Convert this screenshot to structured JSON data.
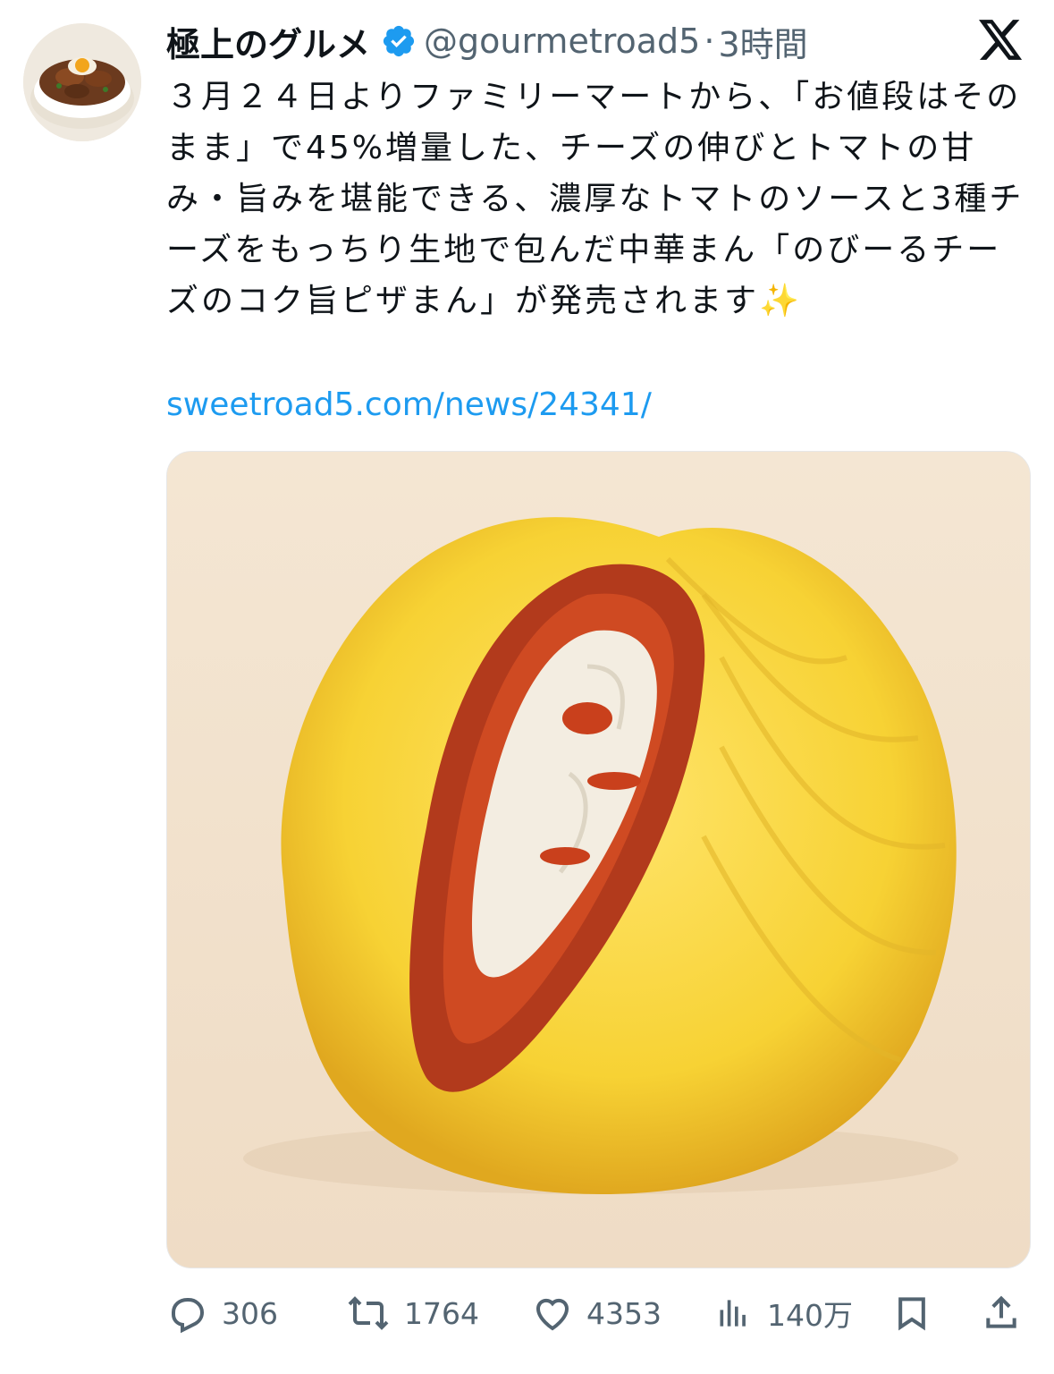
{
  "tweet": {
    "display_name": "極上のグルメ",
    "handle": "@gourmetroad5",
    "separator": "·",
    "time": "3時間",
    "text": "３月２４日よりファミリーマートから、「お値段はそのまま」で45%増量した、チーズの伸びとトマトの甘み・旨みを堪能できる、濃厚なトマトのソースと3種チーズをもっちり生地で包んだ中華まん「のびーるチーズのコク旨ピザまん」が発売されます",
    "sparkle": "✨",
    "link": "sweetroad5.com/news/24341/"
  },
  "icons": {
    "avatar": "avatar-food-bowl",
    "verified": "verified-badge-icon",
    "platform": "x-logo-icon",
    "media": "pizza-bun-image"
  },
  "actions": {
    "replies": "306",
    "retweets": "1764",
    "likes": "4353",
    "views": "140万"
  },
  "colors": {
    "link": "#1d9bf0",
    "verified": "#1d9bf0",
    "muted": "#536471",
    "text": "#0f1419"
  }
}
